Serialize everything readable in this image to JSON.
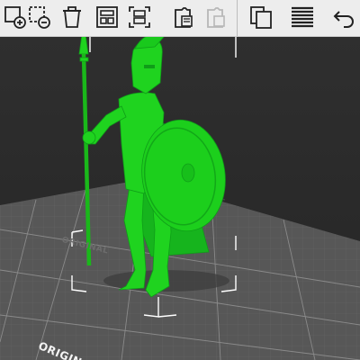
{
  "toolbar": {
    "buttons": [
      {
        "icon": "add-icon",
        "enabled": true
      },
      {
        "icon": "delete-icon",
        "enabled": true
      },
      {
        "icon": "delete-all-icon",
        "enabled": true
      },
      {
        "icon": "arrange-icon",
        "enabled": true
      },
      {
        "icon": "split-icon",
        "enabled": true
      },
      {
        "icon": "copy-icon",
        "enabled": true
      },
      {
        "icon": "paste-icon",
        "enabled": false
      },
      {
        "icon": "layers-icon",
        "enabled": true
      },
      {
        "icon": "variable-layer-height-icon",
        "enabled": true
      },
      {
        "icon": "undo-icon",
        "enabled": true
      }
    ]
  },
  "viewport": {
    "bed_label": "ORIGINAL",
    "bed_label_secondary": "ORIGINAL",
    "model_color": "#1fd31f",
    "bed_color": "#5a5a5a",
    "grid_color": "#7a7a7a",
    "background_color": "#2b2b2b"
  }
}
